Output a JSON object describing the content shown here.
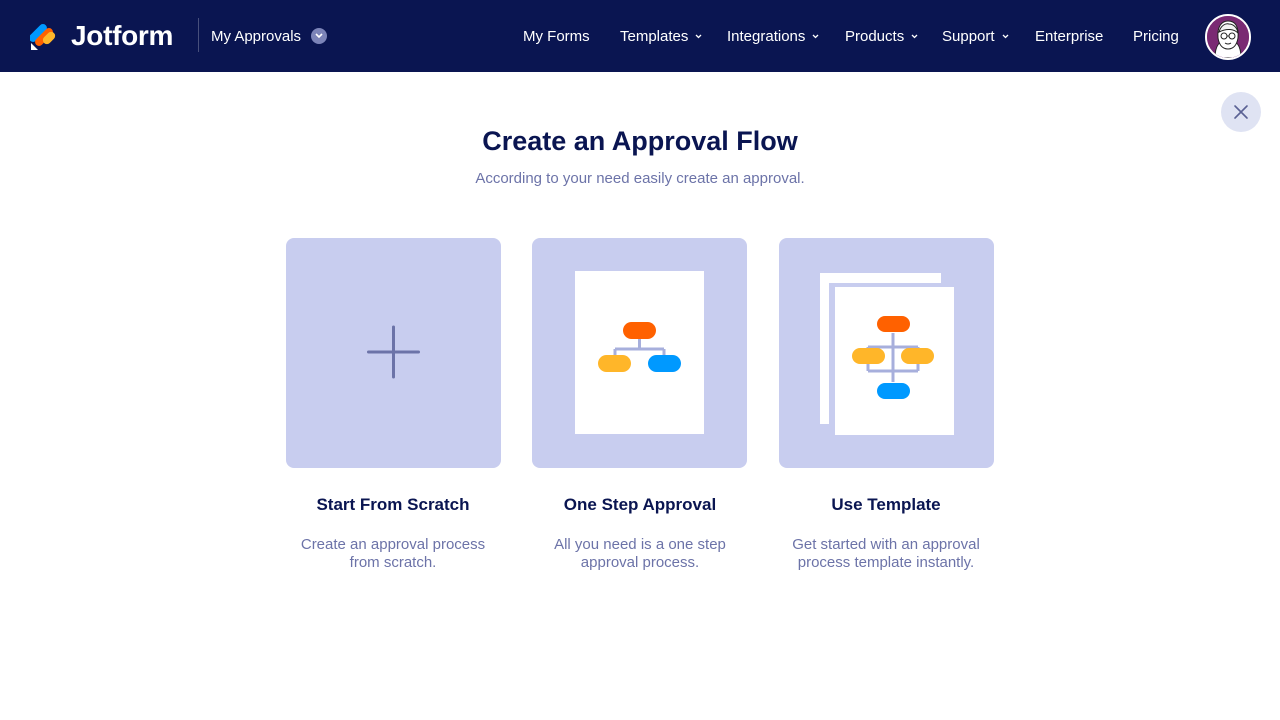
{
  "header": {
    "brand": "Jotform",
    "product": "My Approvals",
    "nav": [
      {
        "label": "My Forms",
        "dropdown": false
      },
      {
        "label": "Templates",
        "dropdown": true
      },
      {
        "label": "Integrations",
        "dropdown": true
      },
      {
        "label": "Products",
        "dropdown": true
      },
      {
        "label": "Support",
        "dropdown": true
      },
      {
        "label": "Enterprise",
        "dropdown": false
      },
      {
        "label": "Pricing",
        "dropdown": false
      }
    ]
  },
  "main": {
    "title": "Create an Approval Flow",
    "subtitle": "According to your need easily create an approval.",
    "options": [
      {
        "title": "Start From Scratch",
        "desc_line1": "Create an approval process",
        "desc_line2": "from scratch.",
        "icon": "plus-icon"
      },
      {
        "title": "One Step Approval",
        "desc_line1": "All you need is a one step",
        "desc_line2": "approval process.",
        "icon": "flowchart-icon"
      },
      {
        "title": "Use Template",
        "desc_line1": "Get started with an approval",
        "desc_line2": "process template instantly.",
        "icon": "template-stack-icon"
      }
    ]
  },
  "colors": {
    "header_bg": "#0a1551",
    "card_bg": "#c8cdef",
    "orange": "#ff6100",
    "yellow": "#ffb629",
    "blue": "#0099ff",
    "connector": "#a7afdc"
  }
}
